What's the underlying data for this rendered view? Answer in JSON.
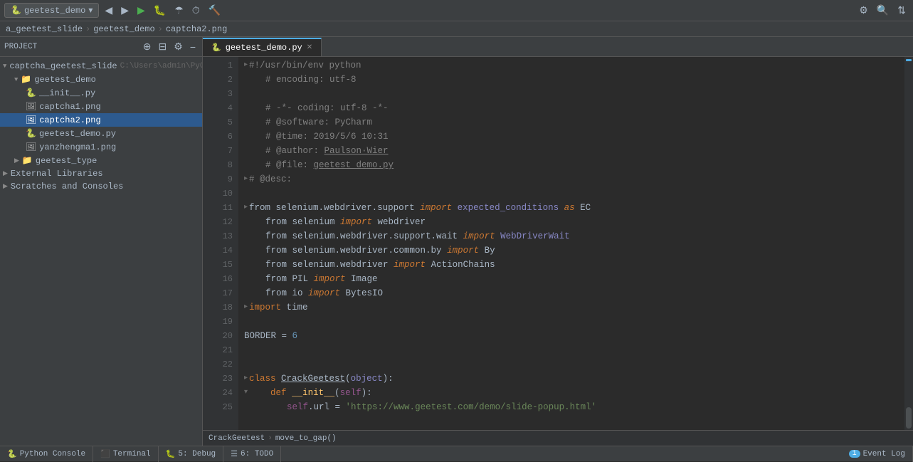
{
  "toolbar": {
    "project_dropdown": "geetest_demo",
    "buttons": [
      "back",
      "forward",
      "run",
      "debug",
      "coverage",
      "profile",
      "build",
      "settings",
      "search",
      "vcs"
    ]
  },
  "breadcrumb": {
    "parts": [
      "a_geetest_slide",
      "geetest_demo",
      "captcha2.png"
    ]
  },
  "sidebar": {
    "title": "Project",
    "items": [
      {
        "label": "captcha_geetest_slide",
        "type": "root",
        "path": "C:\\Users\\admin\\PyCharmP",
        "indent": 0
      },
      {
        "label": "geetest_demo",
        "type": "folder",
        "indent": 1,
        "open": true
      },
      {
        "label": "__init__.py",
        "type": "python",
        "indent": 2
      },
      {
        "label": "captcha1.png",
        "type": "image",
        "indent": 2
      },
      {
        "label": "captcha2.png",
        "type": "image",
        "indent": 2,
        "selected": true
      },
      {
        "label": "geetest_demo.py",
        "type": "python",
        "indent": 2
      },
      {
        "label": "yanzhengma1.png",
        "type": "image",
        "indent": 2
      },
      {
        "label": "geetest_type",
        "type": "folder",
        "indent": 1
      },
      {
        "label": "External Libraries",
        "type": "folder",
        "indent": 0
      },
      {
        "label": "Scratches and Consoles",
        "type": "folder",
        "indent": 0
      }
    ]
  },
  "editor": {
    "tab_name": "geetest_demo.py",
    "lines": [
      {
        "num": 1,
        "content": "#!/usr/bin/env python",
        "type": "shebang"
      },
      {
        "num": 2,
        "content": "# encoding: utf-8",
        "type": "comment"
      },
      {
        "num": 3,
        "content": "",
        "type": "empty"
      },
      {
        "num": 4,
        "content": "# -*- coding: utf-8 -*-",
        "type": "comment"
      },
      {
        "num": 5,
        "content": "# @software: PyCharm",
        "type": "comment"
      },
      {
        "num": 6,
        "content": "# @time: 2019/5/6 10:31",
        "type": "comment"
      },
      {
        "num": 7,
        "content": "# @author: Paulson·Wier",
        "type": "comment"
      },
      {
        "num": 8,
        "content": "# @file: geetest_demo.py",
        "type": "comment"
      },
      {
        "num": 9,
        "content": "# @desc:",
        "type": "comment"
      },
      {
        "num": 10,
        "content": "",
        "type": "empty"
      },
      {
        "num": 11,
        "content": "from selenium.webdriver.support import expected_conditions as EC",
        "type": "import"
      },
      {
        "num": 12,
        "content": "from selenium import webdriver",
        "type": "import"
      },
      {
        "num": 13,
        "content": "from selenium.webdriver.support.wait import WebDriverWait",
        "type": "import"
      },
      {
        "num": 14,
        "content": "from selenium.webdriver.common.by import By",
        "type": "import"
      },
      {
        "num": 15,
        "content": "from selenium.webdriver import ActionChains",
        "type": "import"
      },
      {
        "num": 16,
        "content": "from PIL import Image",
        "type": "import"
      },
      {
        "num": 17,
        "content": "from io import BytesIO",
        "type": "import"
      },
      {
        "num": 18,
        "content": "import time",
        "type": "import"
      },
      {
        "num": 19,
        "content": "",
        "type": "empty"
      },
      {
        "num": 20,
        "content": "BORDER = 6",
        "type": "code"
      },
      {
        "num": 21,
        "content": "",
        "type": "empty"
      },
      {
        "num": 22,
        "content": "",
        "type": "empty"
      },
      {
        "num": 23,
        "content": "class CrackGeetest(object):",
        "type": "class"
      },
      {
        "num": 24,
        "content": "    def __init__(self):",
        "type": "def"
      },
      {
        "num": 25,
        "content": "        self.url = 'https://www.geetest.com/demo/slide-popup.html'",
        "type": "code"
      }
    ],
    "breadcrumb": {
      "class": "CrackGeetest",
      "method": "move_to_gap()"
    }
  },
  "bottom_tabs": [
    {
      "label": "Python Console",
      "active": false
    },
    {
      "label": "Terminal",
      "active": false
    },
    {
      "label": "5: Debug",
      "active": false
    },
    {
      "label": "6: TODO",
      "active": false
    }
  ],
  "status_right": {
    "event_log": "Event Log",
    "badge": "1"
  }
}
